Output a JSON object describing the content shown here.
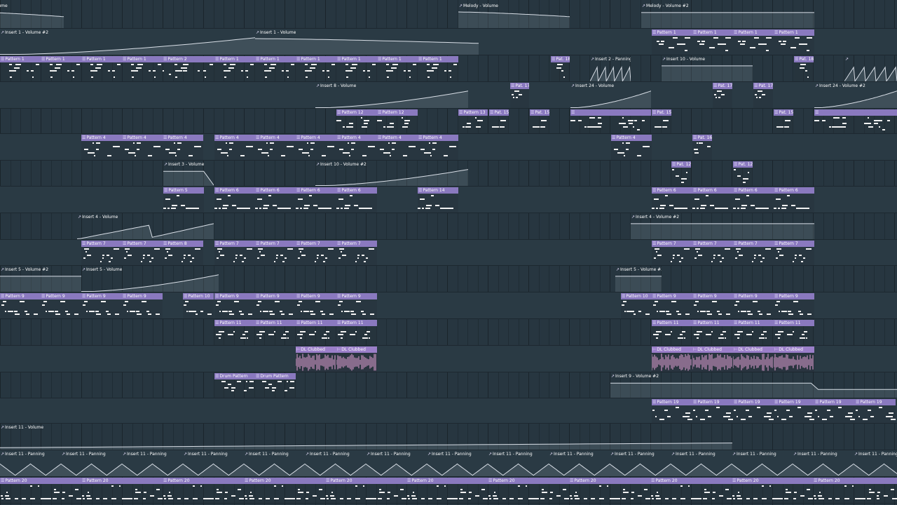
{
  "app": {
    "view": "Playlist - Arrangement"
  },
  "colors": {
    "clip_header": "#8a79bf",
    "audio_wave": "#e8a3d8",
    "note": "#f2f2f2",
    "background": "#273640"
  },
  "icons": {
    "pattern": "pattern-clip-icon",
    "automation": "automation-clip-icon",
    "audio": "audio-clip-icon"
  },
  "tracks": [
    {
      "clips": [
        {
          "type": "automation",
          "label": "aster - Volume",
          "shape": "fall"
        },
        {
          "type": "automation",
          "label": "Melody - Volume",
          "shape": "fall"
        },
        {
          "type": "automation",
          "label": "Melody - Volume #2",
          "shape": "flat"
        }
      ]
    },
    {
      "clips": [
        {
          "type": "automation",
          "label": "Insert 1 - Volume #2",
          "shape": "rise"
        },
        {
          "type": "automation",
          "label": "Insert 1 - Volume",
          "shape": "fall"
        },
        {
          "type": "pattern",
          "label": "Pattern 1"
        },
        {
          "type": "pattern",
          "label": "Pattern 1"
        },
        {
          "type": "pattern",
          "label": "Pattern 1"
        },
        {
          "type": "pattern",
          "label": "Pattern 1"
        }
      ]
    },
    {
      "clips": [
        {
          "type": "pattern",
          "label": "Pattern 1"
        },
        {
          "type": "pattern",
          "label": "Pattern 1"
        },
        {
          "type": "pattern",
          "label": "Pattern 1"
        },
        {
          "type": "pattern",
          "label": "Pattern 1"
        },
        {
          "type": "pattern",
          "label": "Pattern 2"
        },
        {
          "type": "pattern",
          "label": "Pattern 1"
        },
        {
          "type": "pattern",
          "label": "Pattern 1"
        },
        {
          "type": "pattern",
          "label": "Pattern 1"
        },
        {
          "type": "pattern",
          "label": "Pattern 1"
        },
        {
          "type": "pattern",
          "label": "Pattern 1"
        },
        {
          "type": "pattern",
          "label": "Pattern 1"
        },
        {
          "type": "pattern",
          "label": "Pat. 18"
        },
        {
          "type": "automation",
          "label": "Insert 2 - Panning",
          "shape": "saw"
        },
        {
          "type": "automation",
          "label": "Insert 10 - Volume",
          "shape": "flat"
        },
        {
          "type": "pattern",
          "label": "Pat. 18"
        },
        {
          "type": "automation",
          "label": "",
          "shape": "saw"
        }
      ]
    },
    {
      "clips": [
        {
          "type": "automation",
          "label": "Insert 8 - Volume",
          "shape": "rise"
        },
        {
          "type": "pattern",
          "label": "Pat. 17"
        },
        {
          "type": "automation",
          "label": "Insert 24 - Volume",
          "shape": "rise"
        },
        {
          "type": "pattern",
          "label": "Pat. 17"
        },
        {
          "type": "pattern",
          "label": "Pat. 17"
        },
        {
          "type": "automation",
          "label": "Insert 24 - Volume #2",
          "shape": "rise"
        }
      ]
    },
    {
      "clips": [
        {
          "type": "pattern",
          "label": "Pattern 12"
        },
        {
          "type": "pattern",
          "label": "Pattern 12"
        },
        {
          "type": "pattern",
          "label": "Pattern 13"
        },
        {
          "type": "pattern",
          "label": "Pat. 15"
        },
        {
          "type": "pattern",
          "label": "Pat. 15"
        },
        {
          "type": "pattern",
          "label": ""
        },
        {
          "type": "pattern",
          "label": "Pat. 15"
        },
        {
          "type": "pattern",
          "label": "Pat. 15"
        },
        {
          "type": "pattern",
          "label": ""
        }
      ]
    },
    {
      "clips": [
        {
          "type": "pattern",
          "label": "Pattern 4"
        },
        {
          "type": "pattern",
          "label": "Pattern 4"
        },
        {
          "type": "pattern",
          "label": "Pattern 4"
        },
        {
          "type": "pattern",
          "label": "Pattern 4"
        },
        {
          "type": "pattern",
          "label": "Pattern 4"
        },
        {
          "type": "pattern",
          "label": "Pattern 4"
        },
        {
          "type": "pattern",
          "label": "Pattern 4"
        },
        {
          "type": "pattern",
          "label": "Pattern 4"
        },
        {
          "type": "pattern",
          "label": "Pattern 4"
        },
        {
          "type": "pattern",
          "label": "Pattern 4"
        },
        {
          "type": "pattern",
          "label": "Pat. 16"
        }
      ]
    },
    {
      "clips": [
        {
          "type": "automation",
          "label": "Insert 3 - Volume",
          "shape": "drop"
        },
        {
          "type": "automation",
          "label": "Insert 10 - Volume #2",
          "shape": "rise"
        },
        {
          "type": "pattern",
          "label": "Pat. 12"
        },
        {
          "type": "pattern",
          "label": "Pat. 12"
        }
      ]
    },
    {
      "clips": [
        {
          "type": "pattern",
          "label": "Pattern 5"
        },
        {
          "type": "pattern",
          "label": "Pattern 6"
        },
        {
          "type": "pattern",
          "label": "Pattern 6"
        },
        {
          "type": "pattern",
          "label": "Pattern 6"
        },
        {
          "type": "pattern",
          "label": "Pattern 6"
        },
        {
          "type": "pattern",
          "label": "Pattern 14"
        },
        {
          "type": "pattern",
          "label": "Pattern 6"
        },
        {
          "type": "pattern",
          "label": "Pattern 6"
        },
        {
          "type": "pattern",
          "label": "Pattern 6"
        },
        {
          "type": "pattern",
          "label": "Pattern 6"
        }
      ]
    },
    {
      "clips": [
        {
          "type": "automation",
          "label": "Insert 4 - Volume",
          "shape": "ramp2"
        },
        {
          "type": "automation",
          "label": "Insert 4 - Volume #2",
          "shape": "flat"
        }
      ]
    },
    {
      "clips": [
        {
          "type": "pattern",
          "label": "Pattern 7"
        },
        {
          "type": "pattern",
          "label": "Pattern 7"
        },
        {
          "type": "pattern",
          "label": "Pattern 8"
        },
        {
          "type": "pattern",
          "label": "Pattern 7"
        },
        {
          "type": "pattern",
          "label": "Pattern 7"
        },
        {
          "type": "pattern",
          "label": "Pattern 7"
        },
        {
          "type": "pattern",
          "label": "Pattern 7"
        },
        {
          "type": "pattern",
          "label": "Pattern 7"
        },
        {
          "type": "pattern",
          "label": "Pattern 7"
        },
        {
          "type": "pattern",
          "label": "Pattern 7"
        },
        {
          "type": "pattern",
          "label": "Pattern 7"
        }
      ]
    },
    {
      "clips": [
        {
          "type": "automation",
          "label": "Insert 5 - Volume #2",
          "shape": "flat"
        },
        {
          "type": "automation",
          "label": "Insert 5 - Volume",
          "shape": "rise"
        },
        {
          "type": "automation",
          "label": "Insert 5 - Volume #3",
          "shape": "flat"
        }
      ]
    },
    {
      "clips": [
        {
          "type": "pattern",
          "label": "Pattern 9"
        },
        {
          "type": "pattern",
          "label": "Pattern 9"
        },
        {
          "type": "pattern",
          "label": "Pattern 9"
        },
        {
          "type": "pattern",
          "label": "Pattern 9"
        },
        {
          "type": "pattern",
          "label": "Pattern 10"
        },
        {
          "type": "pattern",
          "label": "Pattern 9"
        },
        {
          "type": "pattern",
          "label": "Pattern 9"
        },
        {
          "type": "pattern",
          "label": "Pattern 9"
        },
        {
          "type": "pattern",
          "label": "Pattern 9"
        },
        {
          "type": "pattern",
          "label": "Pattern 10"
        },
        {
          "type": "pattern",
          "label": "Pattern 9"
        },
        {
          "type": "pattern",
          "label": "Pattern 9"
        },
        {
          "type": "pattern",
          "label": "Pattern 9"
        },
        {
          "type": "pattern",
          "label": "Pattern 9"
        }
      ]
    },
    {
      "clips": [
        {
          "type": "pattern",
          "label": "Pattern 11"
        },
        {
          "type": "pattern",
          "label": "Pattern 11"
        },
        {
          "type": "pattern",
          "label": "Pattern 11"
        },
        {
          "type": "pattern",
          "label": "Pattern 11"
        },
        {
          "type": "pattern",
          "label": "Pattern 11"
        },
        {
          "type": "pattern",
          "label": "Pattern 11"
        },
        {
          "type": "pattern",
          "label": "Pattern 11"
        },
        {
          "type": "pattern",
          "label": "Pattern 11"
        }
      ]
    },
    {
      "clips": [
        {
          "type": "audio",
          "label": "DL Clubbed"
        },
        {
          "type": "audio",
          "label": "DL Clubbed"
        },
        {
          "type": "audio",
          "label": "DL Clubbed"
        },
        {
          "type": "audio",
          "label": "DL Clubbed"
        },
        {
          "type": "audio",
          "label": "DL Clubbed"
        },
        {
          "type": "audio",
          "label": "DL Clubbed"
        }
      ]
    },
    {
      "clips": [
        {
          "type": "pattern",
          "label": "Drum Pattern"
        },
        {
          "type": "pattern",
          "label": "Drum Pattern"
        },
        {
          "type": "automation",
          "label": "Insert 9 - Volume #2",
          "shape": "flatdrop"
        }
      ]
    },
    {
      "clips": [
        {
          "type": "pattern",
          "label": "Pattern 19"
        },
        {
          "type": "pattern",
          "label": "Pattern 19"
        },
        {
          "type": "pattern",
          "label": "Pattern 19"
        },
        {
          "type": "pattern",
          "label": "Pattern 19"
        },
        {
          "type": "pattern",
          "label": "Pattern 19"
        },
        {
          "type": "pattern",
          "label": "Pattern 19"
        }
      ]
    },
    {
      "clips": [
        {
          "type": "automation",
          "label": "Insert 11 - Volume",
          "shape": "slowrise"
        }
      ]
    },
    {
      "clips": [
        {
          "type": "automation",
          "label": "Insert 11 - Panning",
          "shape": "tri"
        },
        {
          "type": "automation",
          "label": "Insert 11 - Panning",
          "shape": "tri"
        },
        {
          "type": "automation",
          "label": "Insert 11 - Panning",
          "shape": "tri"
        },
        {
          "type": "automation",
          "label": "Insert 11 - Panning",
          "shape": "tri"
        },
        {
          "type": "automation",
          "label": "Insert 11 - Panning",
          "shape": "tri"
        },
        {
          "type": "automation",
          "label": "Insert 11 - Panning",
          "shape": "tri"
        },
        {
          "type": "automation",
          "label": "Insert 11 - Panning",
          "shape": "tri"
        },
        {
          "type": "automation",
          "label": "Insert 11 - Panning",
          "shape": "tri"
        },
        {
          "type": "automation",
          "label": "Insert 11 - Panning",
          "shape": "tri"
        },
        {
          "type": "automation",
          "label": "Insert 11 - Panning",
          "shape": "tri"
        },
        {
          "type": "automation",
          "label": "Insert 11 - Panning",
          "shape": "tri"
        },
        {
          "type": "automation",
          "label": "Insert 11 - Panning",
          "shape": "tri"
        },
        {
          "type": "automation",
          "label": "Insert 11 - Panning",
          "shape": "tri"
        },
        {
          "type": "automation",
          "label": "Insert 11 - Panning",
          "shape": "tri"
        },
        {
          "type": "automation",
          "label": "Insert 11 - Panning",
          "shape": "tri"
        }
      ]
    },
    {
      "clips": [
        {
          "type": "pattern",
          "label": "Pattern 20"
        },
        {
          "type": "pattern",
          "label": "Pattern 20"
        },
        {
          "type": "pattern",
          "label": "Pattern 20"
        },
        {
          "type": "pattern",
          "label": "Pattern 20"
        },
        {
          "type": "pattern",
          "label": "Pattern 20"
        },
        {
          "type": "pattern",
          "label": "Pattern 20"
        },
        {
          "type": "pattern",
          "label": "Pattern 20"
        },
        {
          "type": "pattern",
          "label": "Pattern 20"
        },
        {
          "type": "pattern",
          "label": "Pattern 20"
        },
        {
          "type": "pattern",
          "label": "Pattern 20"
        },
        {
          "type": "pattern",
          "label": "Pattern 20"
        }
      ]
    }
  ]
}
